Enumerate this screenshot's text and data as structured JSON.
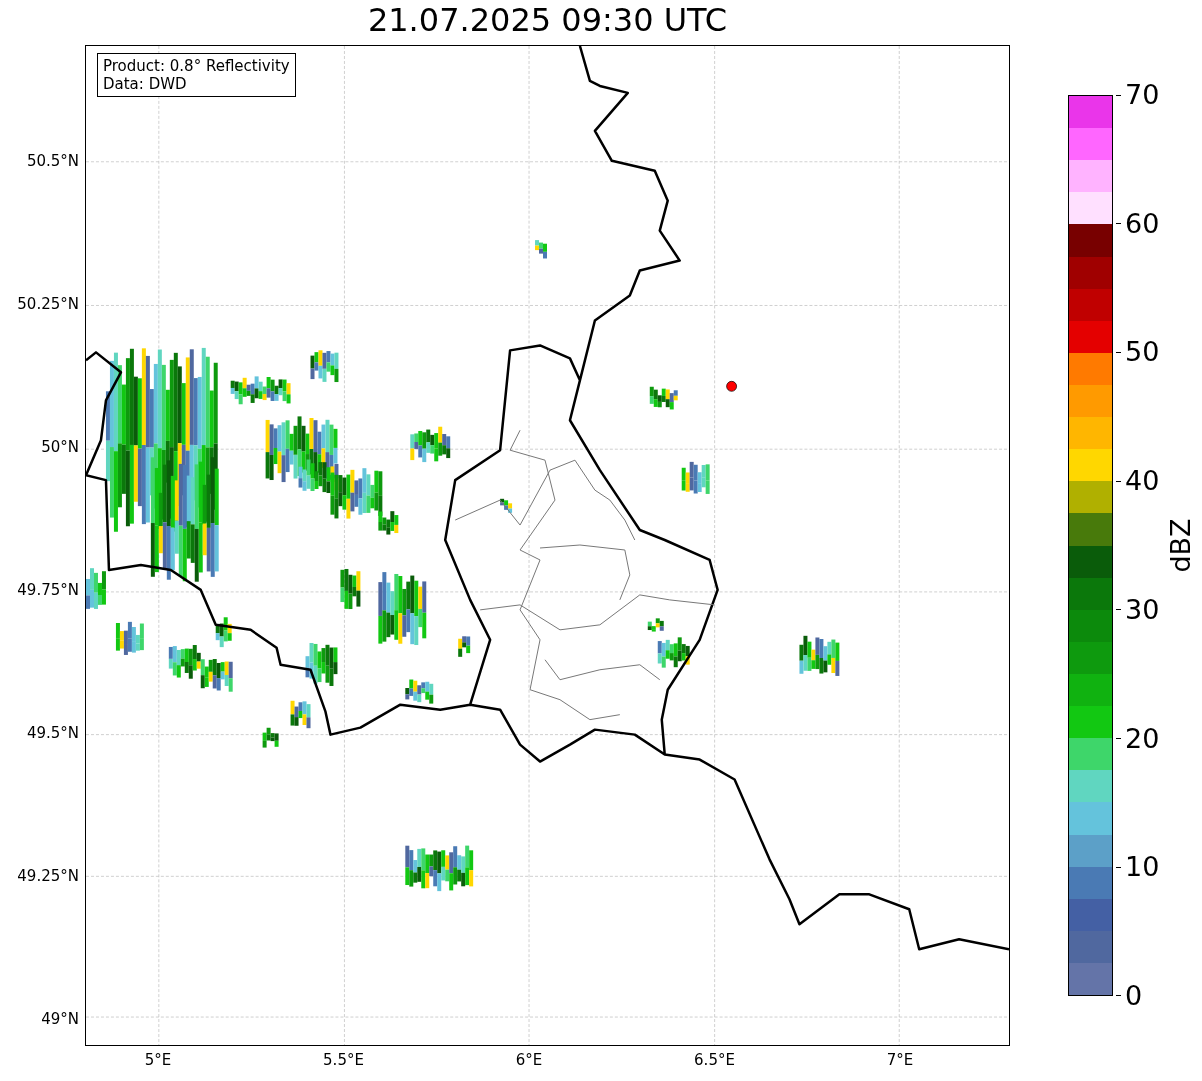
{
  "title": "21.07.2025 09:30 UTC",
  "info_box": {
    "lines": [
      "Product: 0.8° Reflectivity",
      "Data: DWD"
    ]
  },
  "lat_ticks": [
    "50.5°N",
    "50.25°N",
    "50°N",
    "49.75°N",
    "49.5°N",
    "49.25°N",
    "49°N"
  ],
  "lon_ticks": [
    "5°E",
    "5.5°E",
    "6°E",
    "6.5°E",
    "7°E"
  ],
  "colorbar": {
    "label": "dBZ",
    "ticks": [
      "70",
      "60",
      "50",
      "40",
      "30",
      "20",
      "10",
      "0"
    ],
    "segments": [
      {
        "color": "#ea35ea"
      },
      {
        "color": "#ff66ff"
      },
      {
        "color": "#ffb3ff"
      },
      {
        "color": "#ffe0ff"
      },
      {
        "color": "#780000"
      },
      {
        "color": "#a00000"
      },
      {
        "color": "#c00000"
      },
      {
        "color": "#e40000"
      },
      {
        "color": "#ff7a00"
      },
      {
        "color": "#ff9a00"
      },
      {
        "color": "#ffb600"
      },
      {
        "color": "#ffd700"
      },
      {
        "color": "#b0b000"
      },
      {
        "color": "#487a0b"
      },
      {
        "color": "#0a5c0a"
      },
      {
        "color": "#0b780b"
      },
      {
        "color": "#0c8a0c"
      },
      {
        "color": "#0e9a0e"
      },
      {
        "color": "#10b210"
      },
      {
        "color": "#12c812"
      },
      {
        "color": "#3ed66a"
      },
      {
        "color": "#60d6c0"
      },
      {
        "color": "#64c3dc"
      },
      {
        "color": "#5ca0c8"
      },
      {
        "color": "#4a7ab4"
      },
      {
        "color": "#4460a4"
      },
      {
        "color": "#50689f"
      },
      {
        "color": "#6474a8"
      }
    ]
  }
}
